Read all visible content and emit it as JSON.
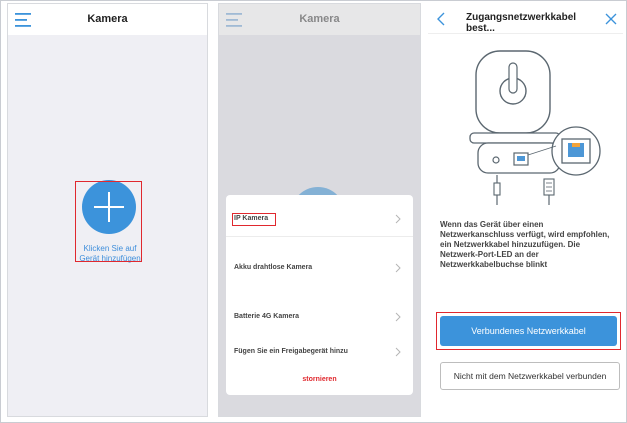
{
  "panel1": {
    "title": "Kamera",
    "add_label_line1": "Klicken Sie auf",
    "add_label_line2": "Gerät hinzufügen"
  },
  "panel2": {
    "title": "Kamera",
    "options": [
      "IP Kamera",
      "Akku drahtlose Kamera",
      "Batterie 4G Kamera",
      "Fügen Sie ein Freigabegerät hinzu"
    ],
    "cancel_label": "stornieren"
  },
  "panel3": {
    "title": "Zugangsnetzwerkkabel best...",
    "instruction": "Wenn das Gerät über einen Netzwerkanschluss verfügt, wird empfohlen, ein Netzwerkkabel hinzuzufügen. Die Netzwerk-Port-LED an der Netzwerkkabelbuchse blinkt",
    "primary_button": "Verbundenes Netzwerkkabel",
    "secondary_button": "Nicht mit dem Netzwerkkabel verbunden"
  },
  "colors": {
    "accent": "#3c93db",
    "highlight_box": "#e0282e",
    "cancel_text": "#e0282e",
    "background_grey": "#efeff4"
  },
  "icons": [
    "menu-icon",
    "plus-icon",
    "chevron-right-icon",
    "back-arrow-icon",
    "close-icon",
    "camera-illustration"
  ]
}
